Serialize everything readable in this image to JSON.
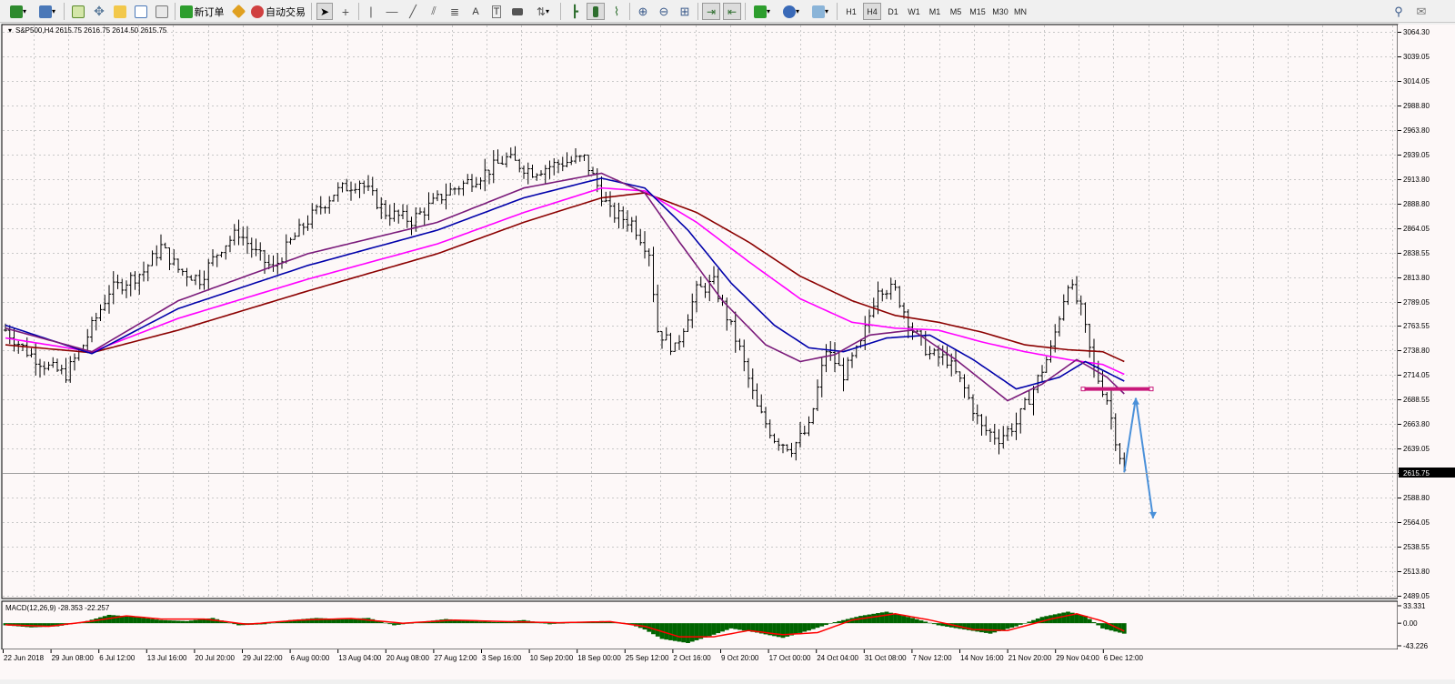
{
  "toolbar": {
    "new_order_label": "新订单",
    "autotrade_label": "自动交易",
    "timeframes": [
      "H1",
      "H4",
      "D1",
      "W1",
      "M1",
      "M5",
      "M15",
      "M30",
      "MN"
    ],
    "active_timeframe": "H4"
  },
  "chart": {
    "header": "S&P500,H4  2615.75 2616.75 2614.50 2615.75",
    "symbol": "S&P500",
    "timeframe": "H4",
    "ohlc": {
      "open": 2615.75,
      "high": 2616.75,
      "low": 2614.5,
      "close": 2615.75
    },
    "current_price_label": "2615.75",
    "colors": {
      "background": "#fdf8f8",
      "grid": "#c8c8c8",
      "bars": "#000000",
      "ma_fast": "#7a1a7a",
      "ma_mid": "#0000aa",
      "ma_magenta": "#ff00ff",
      "ma_slow": "#8b0000",
      "resistance_line": "#c8187a",
      "projection_arrows": "#4a90d9",
      "macd_histogram": "#006400",
      "macd_signal": "#ff0000"
    }
  },
  "chart_data": {
    "type": "line",
    "title": "S&P500,H4",
    "price_axis_labels": [
      "3064.30",
      "3039.05",
      "3014.05",
      "2988.80",
      "2963.80",
      "2939.05",
      "2913.80",
      "2888.80",
      "2864.05",
      "2838.55",
      "2813.80",
      "2789.05",
      "2763.55",
      "2738.80",
      "2714.05",
      "2688.55",
      "2663.80",
      "2639.05",
      "2615.75",
      "2588.80",
      "2564.05",
      "2538.55",
      "2513.80",
      "2489.05"
    ],
    "ylim": [
      2489.05,
      3064.3
    ],
    "x_labels": [
      "22 Jun 2018",
      "29 Jun 08:00",
      "6 Jul 12:00",
      "13 Jul 16:00",
      "20 Jul 20:00",
      "29 Jul 22:00",
      "6 Aug 00:00",
      "13 Aug 04:00",
      "20 Aug 08:00",
      "27 Aug 12:00",
      "3 Sep 16:00",
      "10 Sep 20:00",
      "18 Sep 00:00",
      "25 Sep 12:00",
      "2 Oct 16:00",
      "9 Oct 20:00",
      "17 Oct 00:00",
      "24 Oct 04:00",
      "31 Oct 08:00",
      "7 Nov 12:00",
      "14 Nov 16:00",
      "21 Nov 20:00",
      "29 Nov 04:00",
      "6 Dec 12:00"
    ],
    "price_keypoints": [
      [
        0,
        2760
      ],
      [
        5,
        2738
      ],
      [
        10,
        2722
      ],
      [
        14,
        2715
      ],
      [
        18,
        2745
      ],
      [
        24,
        2800
      ],
      [
        28,
        2810
      ],
      [
        32,
        2820
      ],
      [
        36,
        2845
      ],
      [
        40,
        2822
      ],
      [
        45,
        2812
      ],
      [
        50,
        2845
      ],
      [
        54,
        2860
      ],
      [
        58,
        2838
      ],
      [
        62,
        2822
      ],
      [
        66,
        2850
      ],
      [
        70,
        2872
      ],
      [
        76,
        2900
      ],
      [
        82,
        2912
      ],
      [
        88,
        2880
      ],
      [
        94,
        2872
      ],
      [
        102,
        2900
      ],
      [
        110,
        2918
      ],
      [
        116,
        2935
      ],
      [
        122,
        2922
      ],
      [
        128,
        2930
      ],
      [
        134,
        2935
      ],
      [
        140,
        2880
      ],
      [
        145,
        2870
      ],
      [
        149,
        2840
      ],
      [
        151,
        2760
      ],
      [
        155,
        2740
      ],
      [
        160,
        2800
      ],
      [
        164,
        2808
      ],
      [
        170,
        2740
      ],
      [
        174,
        2680
      ],
      [
        178,
        2650
      ],
      [
        182,
        2640
      ],
      [
        186,
        2660
      ],
      [
        190,
        2740
      ],
      [
        194,
        2715
      ],
      [
        198,
        2745
      ],
      [
        202,
        2805
      ],
      [
        206,
        2800
      ],
      [
        210,
        2760
      ],
      [
        214,
        2735
      ],
      [
        218,
        2730
      ],
      [
        222,
        2700
      ],
      [
        226,
        2660
      ],
      [
        230,
        2650
      ],
      [
        234,
        2665
      ],
      [
        238,
        2700
      ],
      [
        242,
        2740
      ],
      [
        246,
        2810
      ],
      [
        249,
        2780
      ],
      [
        252,
        2720
      ],
      [
        255,
        2690
      ],
      [
        257,
        2650
      ],
      [
        259,
        2615
      ]
    ],
    "series": [
      {
        "name": "MA fast",
        "keypoints": [
          [
            0,
            2762
          ],
          [
            20,
            2738
          ],
          [
            40,
            2790
          ],
          [
            70,
            2838
          ],
          [
            100,
            2870
          ],
          [
            120,
            2905
          ],
          [
            138,
            2920
          ],
          [
            148,
            2900
          ],
          [
            156,
            2850
          ],
          [
            166,
            2790
          ],
          [
            176,
            2745
          ],
          [
            184,
            2728
          ],
          [
            192,
            2735
          ],
          [
            200,
            2755
          ],
          [
            210,
            2760
          ],
          [
            220,
            2730
          ],
          [
            232,
            2688
          ],
          [
            240,
            2705
          ],
          [
            248,
            2730
          ],
          [
            255,
            2712
          ],
          [
            259,
            2695
          ]
        ]
      },
      {
        "name": "MA mid",
        "keypoints": [
          [
            0,
            2765
          ],
          [
            20,
            2736
          ],
          [
            40,
            2782
          ],
          [
            70,
            2826
          ],
          [
            100,
            2862
          ],
          [
            120,
            2895
          ],
          [
            138,
            2915
          ],
          [
            148,
            2905
          ],
          [
            158,
            2862
          ],
          [
            168,
            2808
          ],
          [
            178,
            2765
          ],
          [
            186,
            2742
          ],
          [
            194,
            2738
          ],
          [
            204,
            2752
          ],
          [
            214,
            2755
          ],
          [
            224,
            2730
          ],
          [
            234,
            2700
          ],
          [
            244,
            2712
          ],
          [
            250,
            2728
          ],
          [
            259,
            2708
          ]
        ]
      },
      {
        "name": "MA magenta",
        "keypoints": [
          [
            0,
            2752
          ],
          [
            20,
            2738
          ],
          [
            40,
            2772
          ],
          [
            70,
            2812
          ],
          [
            100,
            2848
          ],
          [
            120,
            2880
          ],
          [
            138,
            2905
          ],
          [
            148,
            2902
          ],
          [
            160,
            2870
          ],
          [
            172,
            2830
          ],
          [
            184,
            2792
          ],
          [
            196,
            2768
          ],
          [
            206,
            2762
          ],
          [
            216,
            2760
          ],
          [
            226,
            2748
          ],
          [
            236,
            2738
          ],
          [
            246,
            2730
          ],
          [
            254,
            2725
          ],
          [
            259,
            2715
          ]
        ]
      },
      {
        "name": "MA slow",
        "keypoints": [
          [
            0,
            2745
          ],
          [
            20,
            2737
          ],
          [
            40,
            2760
          ],
          [
            70,
            2800
          ],
          [
            100,
            2838
          ],
          [
            120,
            2870
          ],
          [
            138,
            2895
          ],
          [
            148,
            2900
          ],
          [
            160,
            2880
          ],
          [
            172,
            2850
          ],
          [
            184,
            2815
          ],
          [
            196,
            2790
          ],
          [
            206,
            2775
          ],
          [
            216,
            2768
          ],
          [
            226,
            2758
          ],
          [
            236,
            2745
          ],
          [
            246,
            2740
          ],
          [
            254,
            2738
          ],
          [
            259,
            2728
          ]
        ]
      }
    ],
    "resistance_level": 2700,
    "projection_targets": [
      2700,
      2568
    ],
    "macd": {
      "label": "MACD(12,26,9) -28.353 -22.257",
      "axis_labels": [
        "33.331",
        "0.00",
        "-43.226"
      ],
      "ylim": [
        -43.226,
        33.331
      ],
      "histogram_keypoints": [
        [
          0,
          -4
        ],
        [
          6,
          -8
        ],
        [
          12,
          -6
        ],
        [
          18,
          2
        ],
        [
          24,
          16
        ],
        [
          30,
          12
        ],
        [
          36,
          6
        ],
        [
          42,
          4
        ],
        [
          48,
          10
        ],
        [
          54,
          -4
        ],
        [
          60,
          -2
        ],
        [
          66,
          6
        ],
        [
          72,
          10
        ],
        [
          78,
          8
        ],
        [
          84,
          10
        ],
        [
          90,
          -4
        ],
        [
          96,
          2
        ],
        [
          102,
          8
        ],
        [
          108,
          4
        ],
        [
          114,
          2
        ],
        [
          120,
          6
        ],
        [
          126,
          -2
        ],
        [
          132,
          2
        ],
        [
          138,
          4
        ],
        [
          144,
          0
        ],
        [
          148,
          -12
        ],
        [
          152,
          -30
        ],
        [
          158,
          -38
        ],
        [
          164,
          -22
        ],
        [
          168,
          -10
        ],
        [
          174,
          -18
        ],
        [
          180,
          -28
        ],
        [
          186,
          -14
        ],
        [
          192,
          2
        ],
        [
          198,
          14
        ],
        [
          204,
          22
        ],
        [
          210,
          10
        ],
        [
          216,
          -4
        ],
        [
          222,
          -12
        ],
        [
          228,
          -20
        ],
        [
          234,
          -6
        ],
        [
          240,
          12
        ],
        [
          246,
          22
        ],
        [
          250,
          14
        ],
        [
          254,
          -10
        ],
        [
          259,
          -20
        ]
      ],
      "signal_keypoints": [
        [
          0,
          -3
        ],
        [
          10,
          -6
        ],
        [
          20,
          4
        ],
        [
          28,
          14
        ],
        [
          36,
          8
        ],
        [
          46,
          8
        ],
        [
          56,
          -2
        ],
        [
          68,
          6
        ],
        [
          80,
          9
        ],
        [
          92,
          0
        ],
        [
          104,
          6
        ],
        [
          116,
          3
        ],
        [
          128,
          1
        ],
        [
          140,
          3
        ],
        [
          148,
          -6
        ],
        [
          156,
          -26
        ],
        [
          164,
          -26
        ],
        [
          172,
          -14
        ],
        [
          180,
          -22
        ],
        [
          188,
          -18
        ],
        [
          196,
          6
        ],
        [
          206,
          18
        ],
        [
          214,
          6
        ],
        [
          224,
          -12
        ],
        [
          232,
          -14
        ],
        [
          242,
          8
        ],
        [
          248,
          18
        ],
        [
          254,
          4
        ],
        [
          259,
          -15
        ]
      ]
    }
  }
}
